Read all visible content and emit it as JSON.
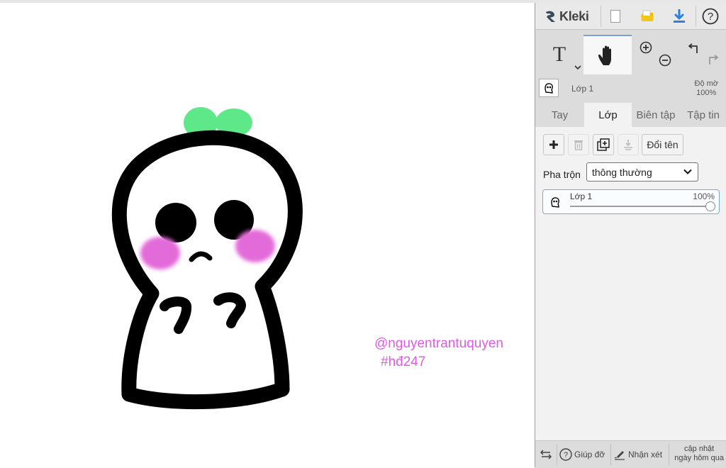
{
  "app": {
    "name": "Kleki"
  },
  "header": {
    "icons": [
      "kleki-logo-icon",
      "new-file-icon",
      "open-folder-icon",
      "download-icon",
      "help-icon"
    ],
    "colors": {
      "folder": "#f0b600",
      "download": "#2f7fdc"
    }
  },
  "tools": {
    "text_glyph": "T",
    "items": [
      "text-tool-icon",
      "hand-tool-icon",
      "zoom-in-icon",
      "zoom-out-icon",
      "undo-icon",
      "redo-icon"
    ],
    "active": "hand-tool-icon"
  },
  "layer_info": {
    "name": "Lớp 1",
    "opacity_label": "Độ mờ",
    "opacity_value": "100%"
  },
  "tabs": [
    {
      "label": "Tay",
      "active": false
    },
    {
      "label": "Lớp",
      "active": true
    },
    {
      "label": "Biên tập",
      "active": false
    },
    {
      "label": "Tập tin",
      "active": false
    }
  ],
  "layers_panel": {
    "buttons": {
      "add_icon": "plus-icon",
      "delete_icon": "trash-icon",
      "duplicate_icon": "duplicate-icon",
      "merge_icon": "merge-down-icon",
      "rename_label": "Đổi tên"
    },
    "blend_label": "Pha trộn",
    "blend_value": "thông thường",
    "layers": [
      {
        "name": "Lớp 1",
        "opacity": "100%",
        "opacity_fraction": 1.0
      }
    ]
  },
  "canvas": {
    "signature_line1": "@nguyentrantuquyen",
    "signature_line2": "#hđ247",
    "colors": {
      "ink": "#000000",
      "leaf": "#5ee889",
      "blush": "#e36ad9",
      "signature": "#e05ae3"
    }
  },
  "footer": {
    "swap_icon": "swap-arrows-icon",
    "help_label": "Giúp đỡ",
    "feedback_label": "Nhận xét",
    "update_line1": "cập nhật",
    "update_line2": "ngày hôm qua"
  }
}
